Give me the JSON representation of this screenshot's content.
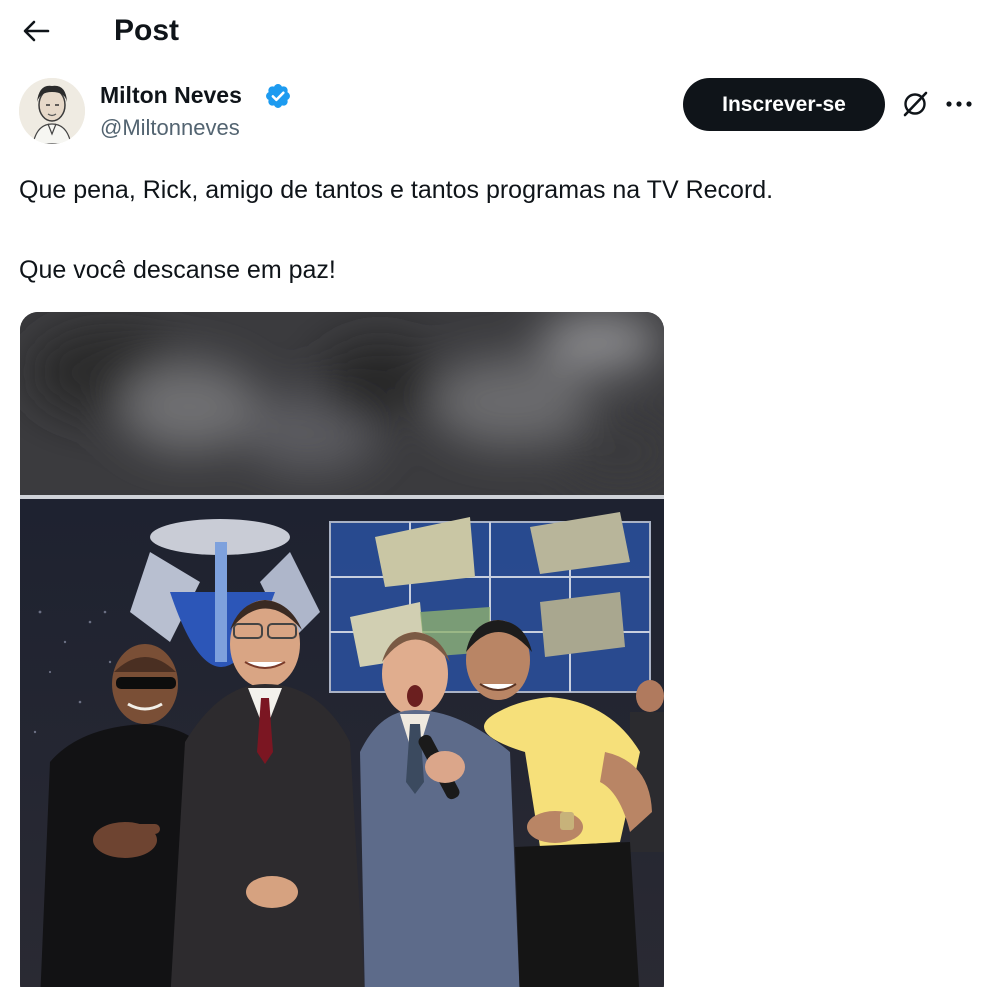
{
  "header": {
    "title": "Post",
    "back_icon": "arrow-left-icon"
  },
  "author": {
    "name": "Milton Neves",
    "handle": "@Miltonneves",
    "verified": true,
    "verified_color": "#1d9bf0"
  },
  "actions": {
    "subscribe_label": "Inscrever-se",
    "grok_icon": "grok-icon",
    "more_icon": "more-horizontal-icon"
  },
  "post": {
    "paragraphs": [
      "Que pena, Rick, amigo de tantos e tantos programas na TV Record.",
      "Que você descanse em paz!"
    ]
  },
  "colors": {
    "text": "#0f1419",
    "secondary": "#536471",
    "button_bg": "#0f1419"
  }
}
